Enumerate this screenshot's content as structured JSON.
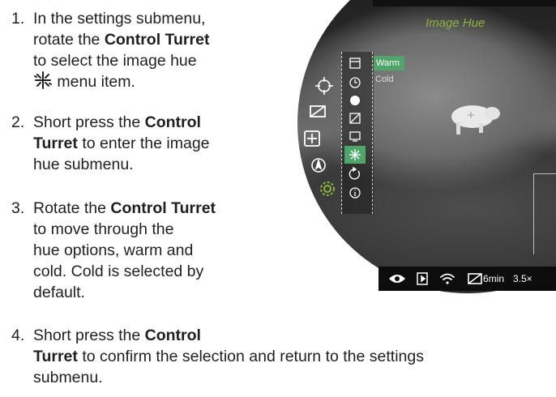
{
  "steps": [
    {
      "num": "1.",
      "parts": {
        "a": "In the settings submenu,",
        "b": "rotate the ",
        "b_bold": "Control Turret",
        "c": "to select the image hue",
        "d": " menu item."
      }
    },
    {
      "num": "2.",
      "parts": {
        "a": "Short press the ",
        "a_bold": "Control",
        "b_bold": "Turret",
        "b": " to enter the image",
        "c": "hue submenu."
      }
    },
    {
      "num": "3.",
      "parts": {
        "a": "Rotate the ",
        "a_bold": "Control Turret",
        "b": "to move through the",
        "c": "hue options, warm and",
        "d": "cold. Cold is selected by",
        "e": "default."
      }
    },
    {
      "num": "4.",
      "parts": {
        "a": "Short press the ",
        "a_bold": "Control",
        "b_bold": "Turret",
        "b": " to confirm the selection and return to the settings",
        "c": "submenu."
      }
    }
  ],
  "scope": {
    "menu_title": "Image Hue",
    "options": [
      "Warm",
      "Cold"
    ],
    "selected_option": "Warm",
    "status": {
      "timer": "6min",
      "zoom": "3.5×"
    },
    "accent_color": "#8db43a",
    "highlight_color": "#4fa56a"
  },
  "icons": [
    "crosshair-icon",
    "monitor-icon",
    "pip-icon",
    "compass-icon",
    "gear-icon",
    "calendar-icon",
    "clock-icon",
    "globe-icon",
    "brightness-icon",
    "display-icon",
    "hue-icon",
    "reset-icon",
    "info-icon",
    "eye-icon",
    "record-icon",
    "wifi-icon",
    "battery-icon"
  ]
}
